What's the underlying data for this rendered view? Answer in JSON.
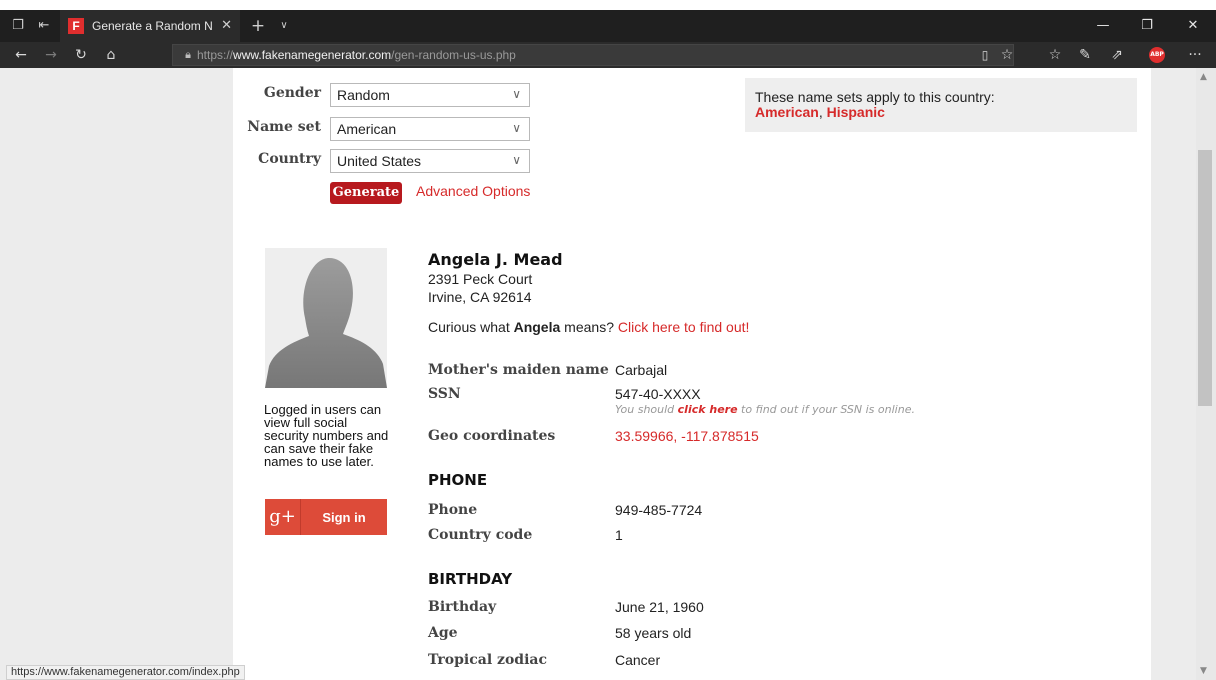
{
  "browser": {
    "tab_title": "Generate a Random Na",
    "favicon_letter": "F",
    "url_scheme": "https://",
    "url_host": "www.fakenamegenerator.com",
    "url_path": "/gen-random-us-us.php",
    "abp_label": "ABP",
    "status_url": "https://www.fakenamegenerator.com/index.php"
  },
  "form": {
    "gender_label": "Gender",
    "gender_value": "Random",
    "nameset_label": "Name set",
    "nameset_value": "American",
    "country_label": "Country",
    "country_value": "United States",
    "generate_label": "Generate",
    "advanced_label": "Advanced Options"
  },
  "info": {
    "text": "These name sets apply to this country:",
    "set1": "American",
    "sep": ", ",
    "set2": "Hispanic"
  },
  "sidebar": {
    "login_note": "Logged in users can view full social security numbers and can save their fake names to use later.",
    "signin_label": "Sign in",
    "gplus_label": "g+"
  },
  "person": {
    "name": "Angela J. Mead",
    "street": "2391 Peck Court",
    "city": "Irvine, CA 92614",
    "curious_prefix": "Curious what ",
    "first_name": "Angela",
    "curious_mid": " means? ",
    "curious_link": "Click here to find out!",
    "maiden_label": "Mother's maiden name",
    "maiden_value": "Carbajal",
    "ssn_label": "SSN",
    "ssn_value": "547-40-XXXX",
    "ssn_note_prefix": "You should ",
    "ssn_note_link": "click here",
    "ssn_note_suffix": " to find out if your SSN is online.",
    "geo_label": "Geo coordinates",
    "geo_value": "33.59966, -117.878515"
  },
  "phone": {
    "section_title": "PHONE",
    "phone_label": "Phone",
    "phone_value": "949-485-7724",
    "cc_label": "Country code",
    "cc_value": "1"
  },
  "birthday": {
    "section_title": "BIRTHDAY",
    "birthday_label": "Birthday",
    "birthday_value": "June 21, 1960",
    "age_label": "Age",
    "age_value": "58 years old",
    "zodiac_label": "Tropical zodiac",
    "zodiac_value": "Cancer"
  }
}
